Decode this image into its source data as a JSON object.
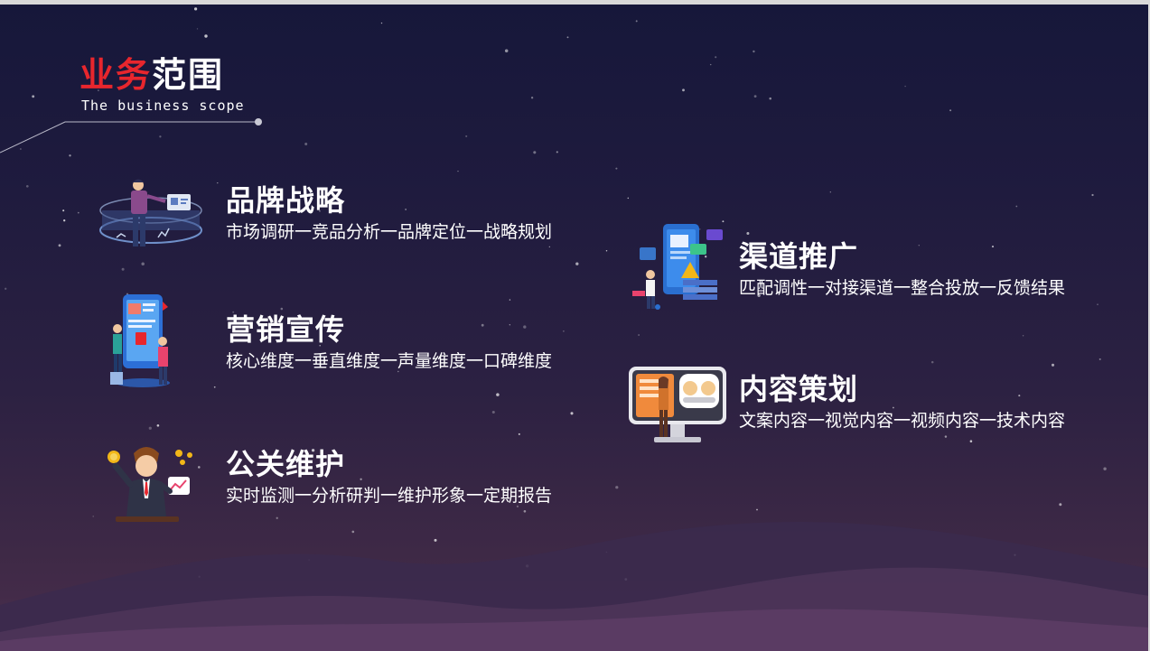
{
  "title": {
    "red_part": "业务",
    "white_part": "范围",
    "subtitle": "The business scope"
  },
  "items": [
    {
      "heading": "品牌战略",
      "desc": "市场调研一竞品分析一品牌定位一战略规划",
      "icon": "data-analyst-icon"
    },
    {
      "heading": "营销宣传",
      "desc": "核心维度一垂直维度一声量维度一口碑维度",
      "icon": "mobile-marketing-icon"
    },
    {
      "heading": "公关维护",
      "desc": "实时监测一分析研判一维护形象一定期报告",
      "icon": "businessman-coins-icon"
    },
    {
      "heading": "渠道推广",
      "desc": "匹配调性一对接渠道一整合投放一反馈结果",
      "icon": "channel-promotion-icon"
    },
    {
      "heading": "内容策划",
      "desc": "文案内容一视觉内容一视频内容一技术内容",
      "icon": "content-screen-icon"
    }
  ],
  "colors": {
    "accent_red": "#e8262d",
    "text": "#ffffff",
    "bg_top": "#16173a",
    "bg_bottom": "#4a2e4d"
  }
}
